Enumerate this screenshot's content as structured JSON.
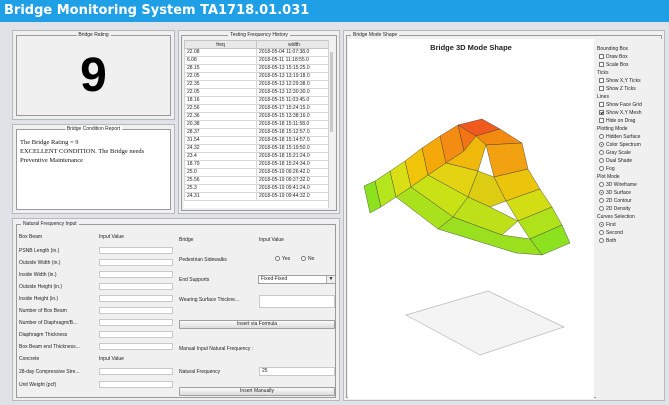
{
  "window": {
    "title": "Bridge Monitoring System TA1718.01.031"
  },
  "rating": {
    "title": "Bridge Rating",
    "value": "9"
  },
  "report": {
    "title": "Bridge Condition Report",
    "line1": "The Bridge Rating = 9",
    "line2": "EXCELLENT CONDITION. The Bridge needs",
    "line3": "Preventive Maintenance"
  },
  "history": {
    "title": "Testing Frequency History",
    "columns": [
      "freq",
      "width"
    ],
    "rows": [
      [
        "22.08",
        "2018-05-04 11:07:38.0"
      ],
      [
        "6.08",
        "2018-05-11 11:18:55.0"
      ],
      [
        "28.15",
        "2018-05-13 15:15:25.0"
      ],
      [
        "22.05",
        "2018-05-13 13:19:18.0"
      ],
      [
        "22.35",
        "2018-05-13 12:29:38.0"
      ],
      [
        "22.05",
        "2018-05-13 12:30:30.0"
      ],
      [
        "18.16",
        "2018-05-15 11:03:45.0"
      ],
      [
        "22.56",
        "2018-05-17 15:24:15.0"
      ],
      [
        "22.36",
        "2018-05-15 13:38:16.0"
      ],
      [
        "20.38",
        "2018-05-18 15:11:58.0"
      ],
      [
        "28.37",
        "2018-05-18 15:12:57.0"
      ],
      [
        "31.54",
        "2018-05-18 15:14:57.0"
      ],
      [
        "24.32",
        "2018-05-18 15:19:50.0"
      ],
      [
        "23.4",
        "2018-05-18 15:21:24.0"
      ],
      [
        "18.79",
        "2018-05-18 15:24:34.0"
      ],
      [
        "25.0",
        "2018-05-19 09:26:42.0"
      ],
      [
        "25.56",
        "2018-05-19 09:37:32.0"
      ],
      [
        "25.3",
        "2018-05-19 09:41:24.0"
      ],
      [
        "24.31",
        "2018-05-19 09:44:32.0"
      ]
    ]
  },
  "input": {
    "title": "Natural Frequency Input",
    "box_beam_heading": "Box Beam",
    "input_value_heading": "Input Value",
    "fields": [
      "PSNB Length (in.)",
      "Outside Width (in.)",
      "Inside Width (in.)",
      "Outside Height (in.)",
      "Inside Height (in.)",
      "Number of Box Beam",
      "Number of Diaphragm/B...",
      "Diaphragm Thickness",
      "Box Beam end Thickness..."
    ],
    "concrete_heading": "Concrete",
    "concrete_fields": [
      "28-day Compressive Stre...",
      "Unit Weight (pcf)"
    ],
    "bridge_heading": "Bridge",
    "pedestrian_label": "Pedestrian Sidewalks",
    "yes_label": "Yes",
    "no_label": "No",
    "end_supports_label": "End Supports",
    "end_supports_value": "Fixed-Fixed",
    "wearing_label": "Wearing Surface Thickne...",
    "insert_formula": "Insert via Formula",
    "manual_heading": "Manual Input Natural Frequency :",
    "natural_freq_label": "Natural Frequency",
    "natural_freq_value": "25",
    "insert_manual": "Insert Manually"
  },
  "mode_shape": {
    "panel_title": "Bridge Mode Shape",
    "chart_title": "Bridge 3D Mode Shape"
  },
  "options": {
    "bounding_box": {
      "heading": "Bounding Box",
      "items": [
        {
          "label": "Draw Box",
          "checked": false
        },
        {
          "label": "Scale Box",
          "checked": false
        }
      ]
    },
    "ticks": {
      "heading": "Ticks",
      "items": [
        {
          "label": "Show X,Y Ticks",
          "checked": false
        },
        {
          "label": "Show Z Ticks",
          "checked": false
        }
      ]
    },
    "lines": {
      "heading": "Lines",
      "items": [
        {
          "label": "Show Face Grid",
          "checked": false
        },
        {
          "label": "Show X,Y Mesh",
          "checked": true
        },
        {
          "label": "Hide on Drag",
          "checked": false
        }
      ]
    },
    "plotting_mode": {
      "heading": "Plotting Mode",
      "items": [
        {
          "label": "Hidden Surface",
          "checked": false
        },
        {
          "label": "Color Spectrum",
          "checked": true
        },
        {
          "label": "Gray Scale",
          "checked": false
        },
        {
          "label": "Dual Shade",
          "checked": false
        },
        {
          "label": "Fog",
          "checked": false
        }
      ]
    },
    "plot_mode": {
      "heading": "Plot Mode",
      "items": [
        {
          "label": "3D Wireframe",
          "checked": false
        },
        {
          "label": "3D Surface",
          "checked": true
        },
        {
          "label": "2D Contour",
          "checked": false
        },
        {
          "label": "2D Density",
          "checked": false
        }
      ]
    },
    "curves": {
      "heading": "Curves Selection",
      "items": [
        {
          "label": "First",
          "checked": true
        },
        {
          "label": "Second",
          "checked": false
        },
        {
          "label": "Both",
          "checked": false
        }
      ]
    }
  },
  "colors": {
    "titlebar": "#1f9fe6",
    "surface_high": "#f05a1e",
    "surface_mid": "#f5b800",
    "surface_low": "#7de01c"
  }
}
